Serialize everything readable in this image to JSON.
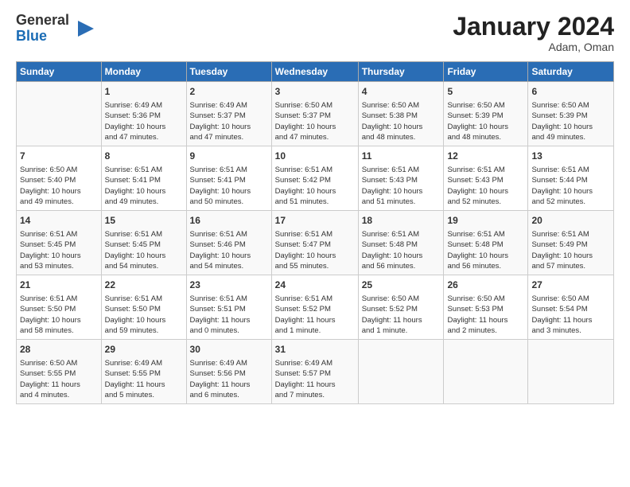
{
  "logo": {
    "line1": "General",
    "line2": "Blue"
  },
  "title": "January 2024",
  "location": "Adam, Oman",
  "headers": [
    "Sunday",
    "Monday",
    "Tuesday",
    "Wednesday",
    "Thursday",
    "Friday",
    "Saturday"
  ],
  "weeks": [
    [
      {
        "day": "",
        "info": ""
      },
      {
        "day": "1",
        "info": "Sunrise: 6:49 AM\nSunset: 5:36 PM\nDaylight: 10 hours\nand 47 minutes."
      },
      {
        "day": "2",
        "info": "Sunrise: 6:49 AM\nSunset: 5:37 PM\nDaylight: 10 hours\nand 47 minutes."
      },
      {
        "day": "3",
        "info": "Sunrise: 6:50 AM\nSunset: 5:37 PM\nDaylight: 10 hours\nand 47 minutes."
      },
      {
        "day": "4",
        "info": "Sunrise: 6:50 AM\nSunset: 5:38 PM\nDaylight: 10 hours\nand 48 minutes."
      },
      {
        "day": "5",
        "info": "Sunrise: 6:50 AM\nSunset: 5:39 PM\nDaylight: 10 hours\nand 48 minutes."
      },
      {
        "day": "6",
        "info": "Sunrise: 6:50 AM\nSunset: 5:39 PM\nDaylight: 10 hours\nand 49 minutes."
      }
    ],
    [
      {
        "day": "7",
        "info": "Sunrise: 6:50 AM\nSunset: 5:40 PM\nDaylight: 10 hours\nand 49 minutes."
      },
      {
        "day": "8",
        "info": "Sunrise: 6:51 AM\nSunset: 5:41 PM\nDaylight: 10 hours\nand 49 minutes."
      },
      {
        "day": "9",
        "info": "Sunrise: 6:51 AM\nSunset: 5:41 PM\nDaylight: 10 hours\nand 50 minutes."
      },
      {
        "day": "10",
        "info": "Sunrise: 6:51 AM\nSunset: 5:42 PM\nDaylight: 10 hours\nand 51 minutes."
      },
      {
        "day": "11",
        "info": "Sunrise: 6:51 AM\nSunset: 5:43 PM\nDaylight: 10 hours\nand 51 minutes."
      },
      {
        "day": "12",
        "info": "Sunrise: 6:51 AM\nSunset: 5:43 PM\nDaylight: 10 hours\nand 52 minutes."
      },
      {
        "day": "13",
        "info": "Sunrise: 6:51 AM\nSunset: 5:44 PM\nDaylight: 10 hours\nand 52 minutes."
      }
    ],
    [
      {
        "day": "14",
        "info": "Sunrise: 6:51 AM\nSunset: 5:45 PM\nDaylight: 10 hours\nand 53 minutes."
      },
      {
        "day": "15",
        "info": "Sunrise: 6:51 AM\nSunset: 5:45 PM\nDaylight: 10 hours\nand 54 minutes."
      },
      {
        "day": "16",
        "info": "Sunrise: 6:51 AM\nSunset: 5:46 PM\nDaylight: 10 hours\nand 54 minutes."
      },
      {
        "day": "17",
        "info": "Sunrise: 6:51 AM\nSunset: 5:47 PM\nDaylight: 10 hours\nand 55 minutes."
      },
      {
        "day": "18",
        "info": "Sunrise: 6:51 AM\nSunset: 5:48 PM\nDaylight: 10 hours\nand 56 minutes."
      },
      {
        "day": "19",
        "info": "Sunrise: 6:51 AM\nSunset: 5:48 PM\nDaylight: 10 hours\nand 56 minutes."
      },
      {
        "day": "20",
        "info": "Sunrise: 6:51 AM\nSunset: 5:49 PM\nDaylight: 10 hours\nand 57 minutes."
      }
    ],
    [
      {
        "day": "21",
        "info": "Sunrise: 6:51 AM\nSunset: 5:50 PM\nDaylight: 10 hours\nand 58 minutes."
      },
      {
        "day": "22",
        "info": "Sunrise: 6:51 AM\nSunset: 5:50 PM\nDaylight: 10 hours\nand 59 minutes."
      },
      {
        "day": "23",
        "info": "Sunrise: 6:51 AM\nSunset: 5:51 PM\nDaylight: 11 hours\nand 0 minutes."
      },
      {
        "day": "24",
        "info": "Sunrise: 6:51 AM\nSunset: 5:52 PM\nDaylight: 11 hours\nand 1 minute."
      },
      {
        "day": "25",
        "info": "Sunrise: 6:50 AM\nSunset: 5:52 PM\nDaylight: 11 hours\nand 1 minute."
      },
      {
        "day": "26",
        "info": "Sunrise: 6:50 AM\nSunset: 5:53 PM\nDaylight: 11 hours\nand 2 minutes."
      },
      {
        "day": "27",
        "info": "Sunrise: 6:50 AM\nSunset: 5:54 PM\nDaylight: 11 hours\nand 3 minutes."
      }
    ],
    [
      {
        "day": "28",
        "info": "Sunrise: 6:50 AM\nSunset: 5:55 PM\nDaylight: 11 hours\nand 4 minutes."
      },
      {
        "day": "29",
        "info": "Sunrise: 6:49 AM\nSunset: 5:55 PM\nDaylight: 11 hours\nand 5 minutes."
      },
      {
        "day": "30",
        "info": "Sunrise: 6:49 AM\nSunset: 5:56 PM\nDaylight: 11 hours\nand 6 minutes."
      },
      {
        "day": "31",
        "info": "Sunrise: 6:49 AM\nSunset: 5:57 PM\nDaylight: 11 hours\nand 7 minutes."
      },
      {
        "day": "",
        "info": ""
      },
      {
        "day": "",
        "info": ""
      },
      {
        "day": "",
        "info": ""
      }
    ]
  ]
}
